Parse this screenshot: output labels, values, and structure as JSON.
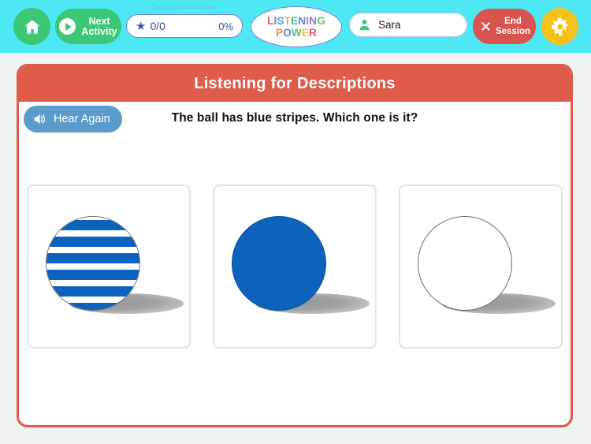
{
  "theme": {
    "topbar_bg": "#4de8f4",
    "page_bg": "#eef2f2",
    "panel_accent": "#df5b4a",
    "green": "#3cc776",
    "yellow": "#f5c21c",
    "red": "#d9534f",
    "blue_button": "#5b9bcb",
    "ball_blue": "#0b63bd"
  },
  "topbar": {
    "home_button": {
      "icon": "home-icon",
      "label": ""
    },
    "next_activity": {
      "label": "Next\nActivity",
      "icon": "play-icon"
    },
    "score": {
      "caption": "Descriptions Score:",
      "icon": "star-icon",
      "fraction": "0/0",
      "percent": "0%"
    },
    "logo": {
      "line1": "LISTENING",
      "line2": "POWER",
      "line1_letters": [
        {
          "ch": "L",
          "color": "#e8546f"
        },
        {
          "ch": "I",
          "color": "#9b6fd6"
        },
        {
          "ch": "S",
          "color": "#3fa9e0"
        },
        {
          "ch": "T",
          "color": "#f0a939"
        },
        {
          "ch": "E",
          "color": "#3fbf9a"
        },
        {
          "ch": "N",
          "color": "#4f8fe0"
        },
        {
          "ch": "I",
          "color": "#e8689a"
        },
        {
          "ch": "N",
          "color": "#9b6fd6"
        },
        {
          "ch": "G",
          "color": "#5ec46a"
        }
      ],
      "line2_letters": [
        {
          "ch": "P",
          "color": "#f08a3c"
        },
        {
          "ch": "O",
          "color": "#4f8fe0"
        },
        {
          "ch": "W",
          "color": "#5ec46a"
        },
        {
          "ch": "E",
          "color": "#f0c63c"
        },
        {
          "ch": "R",
          "color": "#e8546f"
        }
      ]
    },
    "user": {
      "icon": "user-icon",
      "name": "Sara"
    },
    "end_session": {
      "icon": "close-x-icon",
      "label": "End\nSession"
    },
    "settings_button": {
      "icon": "gear-icon"
    }
  },
  "panel": {
    "title": "Listening for Descriptions",
    "hear_again": {
      "icon": "speaker-icon",
      "label": "Hear Again"
    },
    "prompt": "The ball has blue stripes. Which one is it?",
    "choices": [
      {
        "name": "striped-blue-ball",
        "style": "striped",
        "selected": false
      },
      {
        "name": "solid-blue-ball",
        "style": "solid",
        "selected": false
      },
      {
        "name": "plain-white-ball",
        "style": "white",
        "selected": false
      }
    ]
  }
}
